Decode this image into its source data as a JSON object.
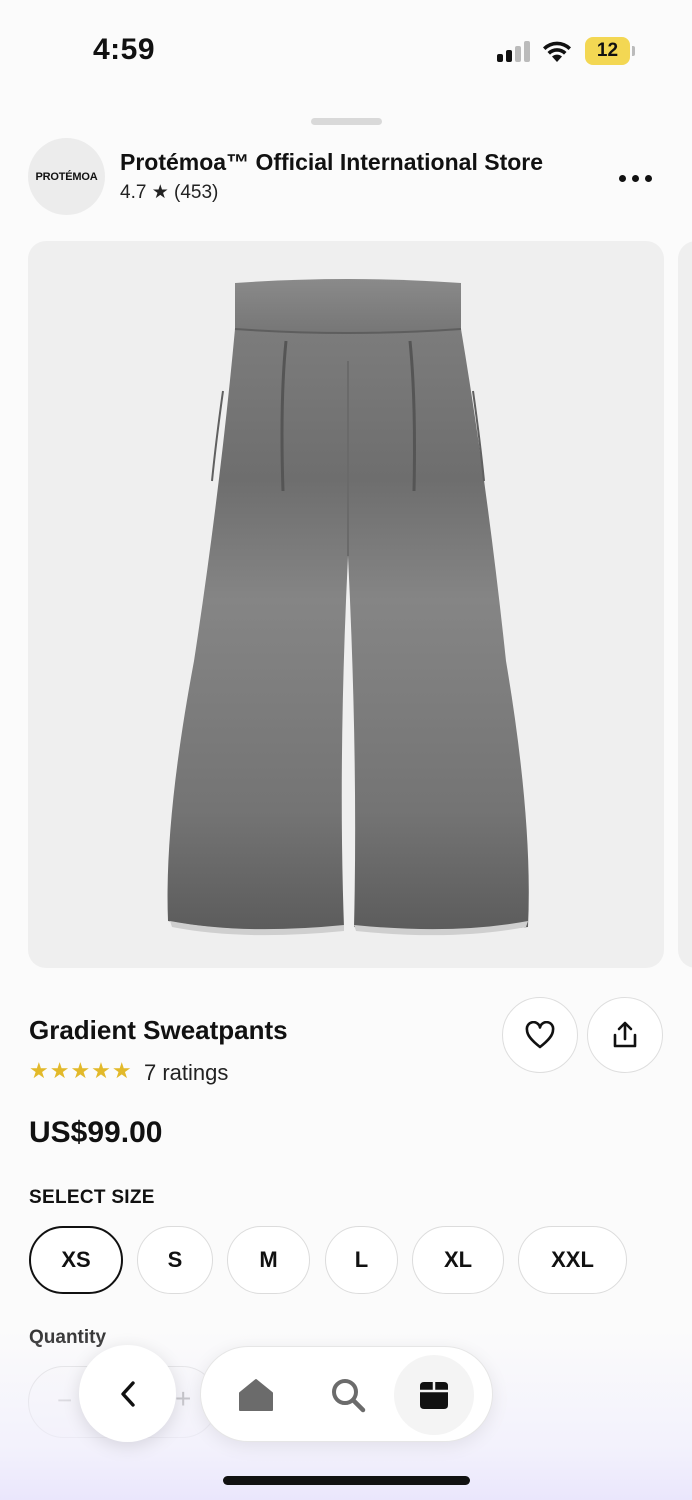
{
  "status_bar": {
    "time": "4:59",
    "battery": "12"
  },
  "store": {
    "logo_text": "PROTÉMOA",
    "name": "Protémoa™ Official International Store",
    "rating": "4.7 ★ (453)"
  },
  "product": {
    "title": "Gradient Sweatpants",
    "stars": "★★★★★",
    "ratings_count": "7 ratings",
    "price": "US$99.00"
  },
  "sizes": {
    "label": "SELECT SIZE",
    "options": [
      "XS",
      "S",
      "M",
      "L",
      "XL",
      "XXL"
    ],
    "selected": "XS"
  },
  "quantity": {
    "label": "Quantity",
    "minus": "−",
    "plus": "+"
  },
  "colors": {
    "accent": "#111111",
    "star": "#e2b92a",
    "battery": "#f2d54a"
  },
  "icons": {
    "more": "more-dots-icon",
    "favorite": "heart-icon",
    "share": "share-icon",
    "back": "chevron-left-icon",
    "home": "home-icon",
    "search": "search-icon",
    "bag": "bag-icon"
  }
}
